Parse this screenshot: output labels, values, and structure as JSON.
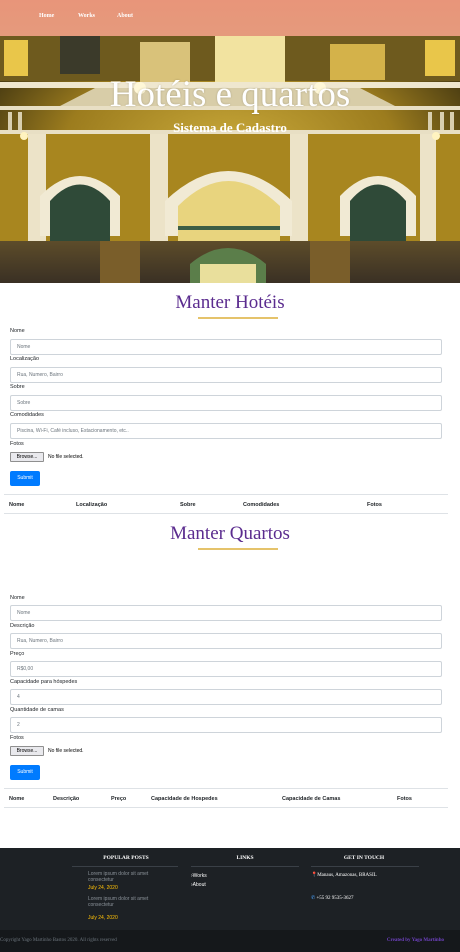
{
  "nav": {
    "items": [
      "Home",
      "Works",
      "About"
    ]
  },
  "hero": {
    "title": "Hotéis e quartos",
    "subtitle": "Sistema de Cadastro"
  },
  "hotels": {
    "title": "Manter Hotéis",
    "fields": [
      {
        "label": "Nome",
        "placeholder": "Nome"
      },
      {
        "label": "Localização",
        "placeholder": "Rua, Numero, Bairro"
      },
      {
        "label": "Sobre",
        "placeholder": "Sobre"
      },
      {
        "label": "Comodidades",
        "placeholder": "Piscina, Wi-Fi, Café incluso, Estacionamento, etc.."
      }
    ],
    "photos_label": "Fotos",
    "browse_label": "Browse...",
    "no_file": "No file selected.",
    "submit": "Submit",
    "columns": [
      "Nome",
      "Localização",
      "Sobre",
      "Comodidades",
      "Fotos"
    ]
  },
  "rooms": {
    "title": "Manter Quartos",
    "fields": [
      {
        "label": "Nome",
        "placeholder": "Nome"
      },
      {
        "label": "Descrição",
        "placeholder": "Rua, Numero, Bairro"
      },
      {
        "label": "Preço",
        "placeholder": "R$0,00"
      },
      {
        "label": "Capacidade para hóspedes",
        "placeholder": "4"
      },
      {
        "label": "Quantidade de camas",
        "placeholder": "2"
      }
    ],
    "photos_label": "Fotos",
    "browse_label": "Browse...",
    "no_file": "No file selected.",
    "submit": "Submit",
    "columns": [
      "Nome",
      "Descrição",
      "Preço",
      "Capacidade de Hospedes",
      "Capacidade de Camas",
      "Fotos"
    ]
  },
  "footer": {
    "popular": {
      "heading": "POPULAR POSTS",
      "posts": [
        {
          "text": "Lorem ipsum dolor sit amet consectetur",
          "date": "July 24, 2020"
        },
        {
          "text": "Lorem ipsum dolor sit amet consectetur",
          "date": "July 24, 2020"
        }
      ]
    },
    "links": {
      "heading": "LINKS",
      "items": [
        "Works",
        "About"
      ]
    },
    "contact": {
      "heading": "GET IN TOUCH",
      "address": "Manaus, Amazonas, BRASIL",
      "phone": "+55 92 9535-3627"
    },
    "copyright": "Copyright Yago Martinho Bastos 2020. All rights reserved",
    "credit": "Created by Yago Martinho"
  }
}
